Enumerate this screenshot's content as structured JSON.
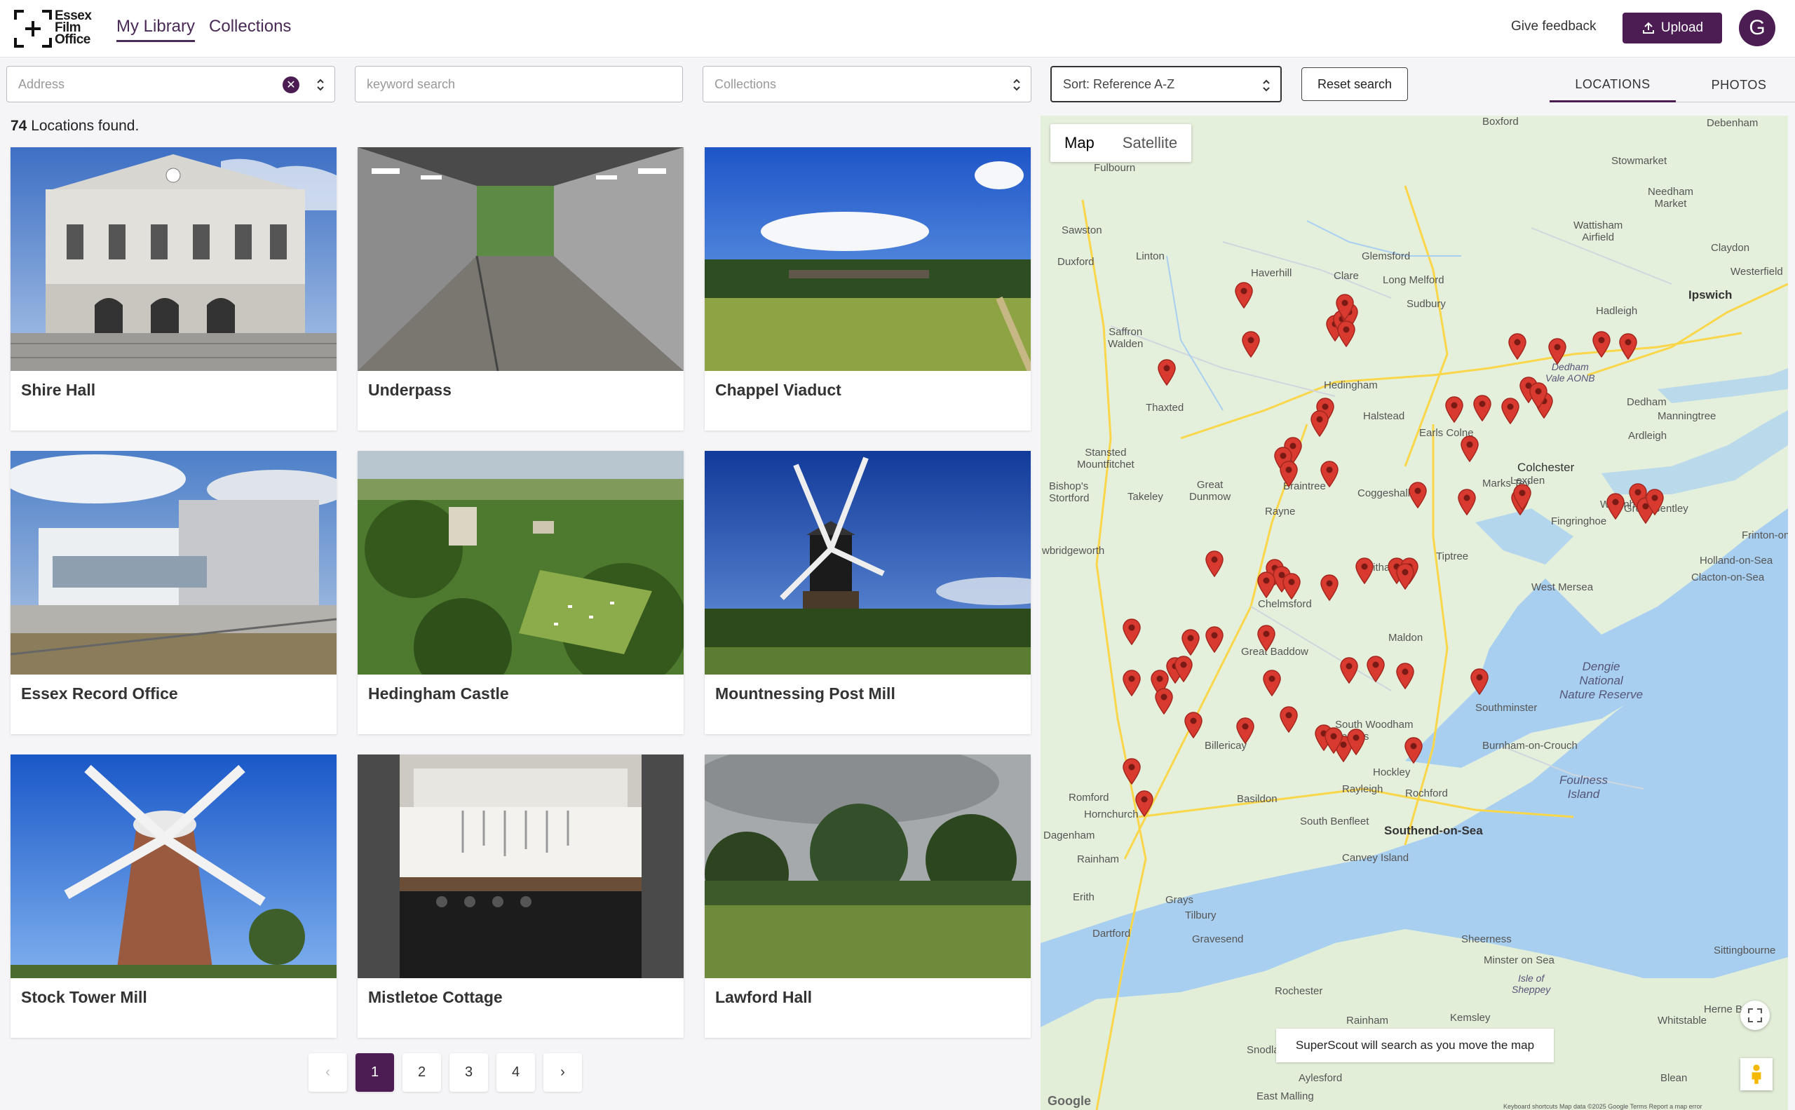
{
  "header": {
    "logo_lines": [
      "Essex",
      "Film",
      "Office"
    ],
    "nav": [
      {
        "label": "My Library",
        "active": true
      },
      {
        "label": "Collections",
        "active": false
      }
    ],
    "feedback_label": "Give feedback",
    "upload_label": "Upload",
    "avatar_letter": "G",
    "accent_color": "#4b1d52"
  },
  "filters": {
    "address_placeholder": "Address",
    "keyword_placeholder": "keyword search",
    "collections_placeholder": "Collections",
    "sort_value": "Sort: Reference A-Z",
    "reset_label": "Reset search",
    "view_tabs": [
      {
        "label": "LOCATIONS",
        "active": true
      },
      {
        "label": "PHOTOS",
        "active": false
      }
    ]
  },
  "results": {
    "count": "74",
    "count_suffix": " Locations found.",
    "locations": [
      {
        "title": "Shire Hall"
      },
      {
        "title": "Underpass"
      },
      {
        "title": "Chappel Viaduct"
      },
      {
        "title": "Essex Record Office"
      },
      {
        "title": "Hedingham Castle"
      },
      {
        "title": "Mountnessing Post Mill"
      },
      {
        "title": "Stock Tower Mill"
      },
      {
        "title": "Mistletoe Cottage"
      },
      {
        "title": "Lawford Hall"
      }
    ]
  },
  "pagination": {
    "prev": "‹",
    "pages": [
      "1",
      "2",
      "3",
      "4"
    ],
    "current": "1",
    "next": "›"
  },
  "map": {
    "toggle": [
      {
        "label": "Map",
        "active": true
      },
      {
        "label": "Satellite",
        "active": false
      }
    ],
    "places": {
      "fulbourn": "Fulbourn",
      "sawston": "Sawston",
      "duxford": "Duxford",
      "linton": "Linton",
      "haverhill": "Haverhill",
      "clare": "Clare",
      "glemsford": "Glemsford",
      "long_melford": "Long Melford",
      "sudbury": "Sudbury",
      "saffron_walden": "Saffron\nWalden",
      "thaxted": "Thaxted",
      "halstead": "Halstead",
      "earls_colne": "Earls Colne",
      "stansted": "Stansted\nMountfitchet",
      "bishops_stortford": "Bishop's\nStortford",
      "takeley": "Takeley",
      "great_dunmow": "Great\nDunmow",
      "coggeshall": "Coggeshall",
      "marks_tey": "Marks Tey",
      "colchester": "Colchester",
      "lexden": "Lexden",
      "wivenhoe": "Wivenhoe",
      "great_bentley": "Great Bentley",
      "witham": "Witham",
      "tiptree": "Tiptree",
      "west_mersea": "West Mersea",
      "holland_on_sea": "Holland-on-Sea",
      "clacton": "Clacton-on-Sea",
      "frinton": "Frinton-on-",
      "great_baddow": "Great Baddow",
      "maldon": "Maldon",
      "dengie": "Dengie\nNational\nNature Reserve",
      "southminster": "Southminster",
      "burnham": "Burnham-on-Crouch",
      "foulness": "Foulness\nIsland",
      "billericay": "Billericay",
      "basildon": "Basildon",
      "hockley": "Hockley",
      "rayleigh": "Rayleigh",
      "rochford": "Rochford",
      "southend": "Southend-on-Sea",
      "south_benfleet": "South Benfleet",
      "canvey": "Canvey Island",
      "romford": "Romford",
      "hornchurch": "Hornchurch",
      "dagenham": "Dagenham",
      "rainham": "Rainham",
      "grays": "Grays",
      "tilbury": "Tilbury",
      "erith": "Erith",
      "dartford": "Dartford",
      "gravesend": "Gravesend",
      "sheerness": "Sheerness",
      "minster": "Minster on Sea",
      "isle_of_sheppey": "Isle of\nSheppey",
      "rochester": "Rochester",
      "rainham_kent": "Rainham",
      "whitstable": "Whitstable",
      "herne_bay": "Herne Bay",
      "ipswich": "Ipswich",
      "hadleigh": "Hadleigh",
      "westerfield": "Westerfield",
      "claydon": "Claydon",
      "stowmarket": "Stowmarket",
      "needham_market": "Needham\nMarket",
      "wattisham": "Wattisham\nAirfield",
      "dedham": "Dedham",
      "manningtree": "Manningtree",
      "ardleigh": "Ardleigh",
      "fingringhoe": "Fingringhoe",
      "bishopsbridgeworth": "wbridgeworth",
      "sittingbourne": "Sittingbourne",
      "snodland": "Snodland",
      "aylesford": "Aylesford",
      "east_malling": "East Malling",
      "blean": "Blean",
      "kemsley": "Kemsley",
      "debenham": "Debenham",
      "boxford": "Boxford",
      "hedingham": "Hedingham",
      "braintree": "Braintree",
      "chelmsford": "Chelmsford",
      "dedham_vale": "Dedham\nVale AONB",
      "south_woodham": "South Woodham\nFerrers",
      "rayne": "Rayne"
    },
    "notice": "SuperScout will search as you move the map",
    "attribution": "Google",
    "footer": "Keyboard shortcuts   Map data ©2025 Google   Terms   Report a map error",
    "pin_color": "#d93a2f",
    "land_color": "#e5f0dc",
    "water_color": "#a8cff0"
  }
}
